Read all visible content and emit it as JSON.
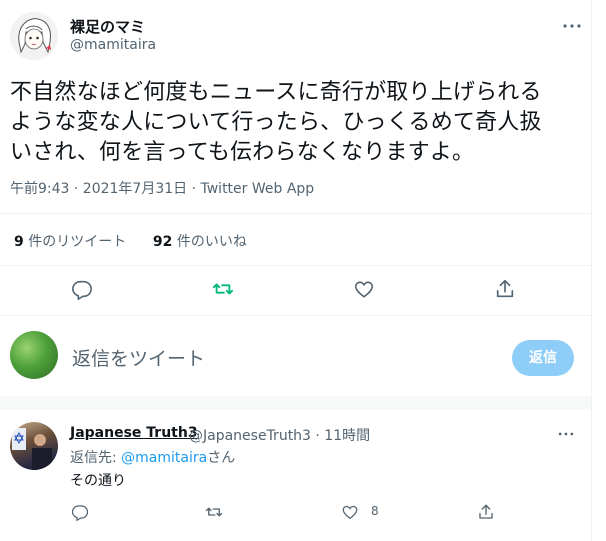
{
  "author": {
    "name": "裸足のマミ",
    "handle": "@mamitaira"
  },
  "tweet": {
    "lines": [
      "不自然なほど何度もニュースに奇行が取り上げられる",
      "ような変な人について行ったら、ひっくるめて奇人扱",
      "いされ、何を言っても伝わらなくなりますよ。"
    ],
    "meta": "午前9:43 · 2021年7月31日 · Twitter Web App"
  },
  "stats": {
    "retweets_count": "9",
    "retweets_label": "件のリツイート",
    "likes_count": "92",
    "likes_label": "件のいいね"
  },
  "actions": {
    "reply_icon": "reply-icon",
    "retweet_icon": "retweet-icon",
    "like_icon": "heart-icon",
    "share_icon": "share-icon",
    "retweet_color": "#00ba7c"
  },
  "compose": {
    "placeholder": "返信をツイート",
    "button_label": "返信"
  },
  "reply": {
    "name": "Japanese Truth3",
    "handle": "@JapaneseTruth3 · 11時間",
    "to_prefix": "返信先: ",
    "to_handle": "@mamitaira",
    "to_suffix": "さん",
    "text": "その通り",
    "like_count": "8"
  },
  "colors": {
    "accent": "#1d9bf0",
    "secondary_text": "#536471",
    "button_disabled": "#8ecdf8"
  }
}
